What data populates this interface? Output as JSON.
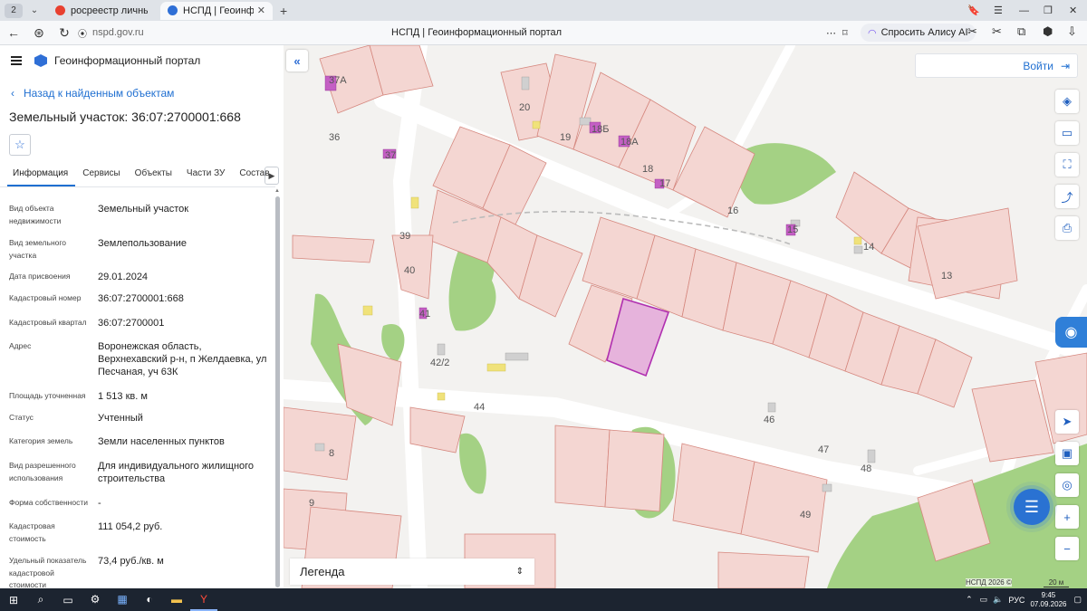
{
  "browser": {
    "tab_count": "2",
    "tabs": [
      {
        "title": "росреестр личный кабинет",
        "active": false,
        "favicon_color": "#e8402f"
      },
      {
        "title": "НСПД | Геоинформационный портал",
        "active": true,
        "favicon_color": "#2f6fd6"
      }
    ],
    "url_host": "nspd.gov.ru",
    "page_title": "НСПД | Геоинформационный портал",
    "alice_label": "Спросить Алису AI"
  },
  "panel": {
    "brand": "Геоинформационный портал",
    "back_link": "Назад к найденным объектам",
    "title": "Земельный участок: 36:07:2700001:668",
    "tabs": [
      "Информация",
      "Сервисы",
      "Объекты",
      "Части ЗУ",
      "Состав"
    ],
    "fields": [
      {
        "label": "Вид объекта недвижимости",
        "value": "Земельный участок"
      },
      {
        "label": "Вид земельного участка",
        "value": "Землепользование"
      },
      {
        "label": "Дата присвоения",
        "value": "29.01.2024"
      },
      {
        "label": "Кадастровый номер",
        "value": "36:07:2700001:668"
      },
      {
        "label": "Кадастровый квартал",
        "value": "36:07:2700001"
      },
      {
        "label": "Адрес",
        "value": "Воронежская область, Верхнехавский р-н, п Желдаевка, ул Песчаная, уч 63К"
      },
      {
        "label": "Площадь уточненная",
        "value": "1 513 кв. м"
      },
      {
        "label": "Статус",
        "value": "Учтенный"
      },
      {
        "label": "Категория земель",
        "value": "Земли населенных пунктов"
      },
      {
        "label": "Вид разрешенного использования",
        "value": "Для индивидуального жилищного строительства"
      },
      {
        "label": "Форма собственности",
        "value": "-"
      },
      {
        "label": "Кадастровая стоимость",
        "value": "111 054,2 руб."
      },
      {
        "label": "Удельный показатель кадастровой стоимости",
        "value": "73,4 руб./кв. м"
      }
    ]
  },
  "map": {
    "login": "Войти",
    "legend": "Легенда",
    "copyright": "НСПД 2026 ©",
    "scale": "20 м",
    "labels": [
      "37А",
      "20",
      "36",
      "19",
      "18Б",
      "18А",
      "37",
      "18",
      "17",
      "16",
      "15",
      "39",
      "14",
      "13",
      "40",
      "41",
      "42/2",
      "44",
      "46",
      "47",
      "48",
      "8",
      "9",
      "49"
    ],
    "colors": {
      "parcel_fill": "#f2d4d0",
      "parcel_stroke": "#d98a80",
      "selected_fill": "#e8b8dc",
      "selected_stroke": "#b02fb0",
      "green": "#9fcf7f",
      "road": "#ffffff",
      "building": "#cfcfcf"
    }
  },
  "taskbar": {
    "language": "РУС",
    "time": "9:45",
    "date": "07.09.2026"
  }
}
